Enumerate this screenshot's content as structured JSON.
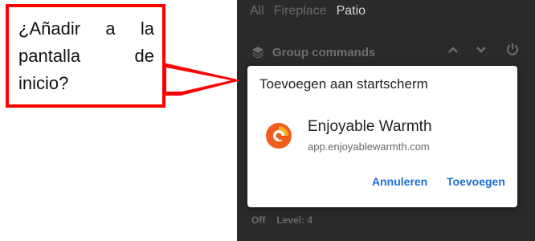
{
  "phone": {
    "tabs": [
      {
        "label": "All",
        "active": false
      },
      {
        "label": "Fireplace",
        "active": false
      },
      {
        "label": "Patio",
        "active": true
      }
    ],
    "group_bar": {
      "label": "Group commands",
      "icons": [
        "layers-icon",
        "chevron-up-icon",
        "chevron-down-icon",
        "power-icon"
      ]
    },
    "footer": {
      "state": "Off",
      "level": "Level: 4"
    }
  },
  "dialog": {
    "title": "Toevoegen aan startscherm",
    "app_name": "Enjoyable Warmth",
    "app_url": "app.enjoyablewarmth.com",
    "app_icon": "enjoyable-warmth-logo",
    "cancel_label": "Annuleren",
    "add_label": "Toevoegen"
  },
  "callout": {
    "text": "¿Añadir a la pantalla de inicio?"
  },
  "colors": {
    "callout_border": "#ff0000",
    "button_text": "#1e6fd0",
    "phone_background": "#2a2a2a",
    "logo_orange": "#f25c1d",
    "logo_yellow": "#f9b11e"
  }
}
